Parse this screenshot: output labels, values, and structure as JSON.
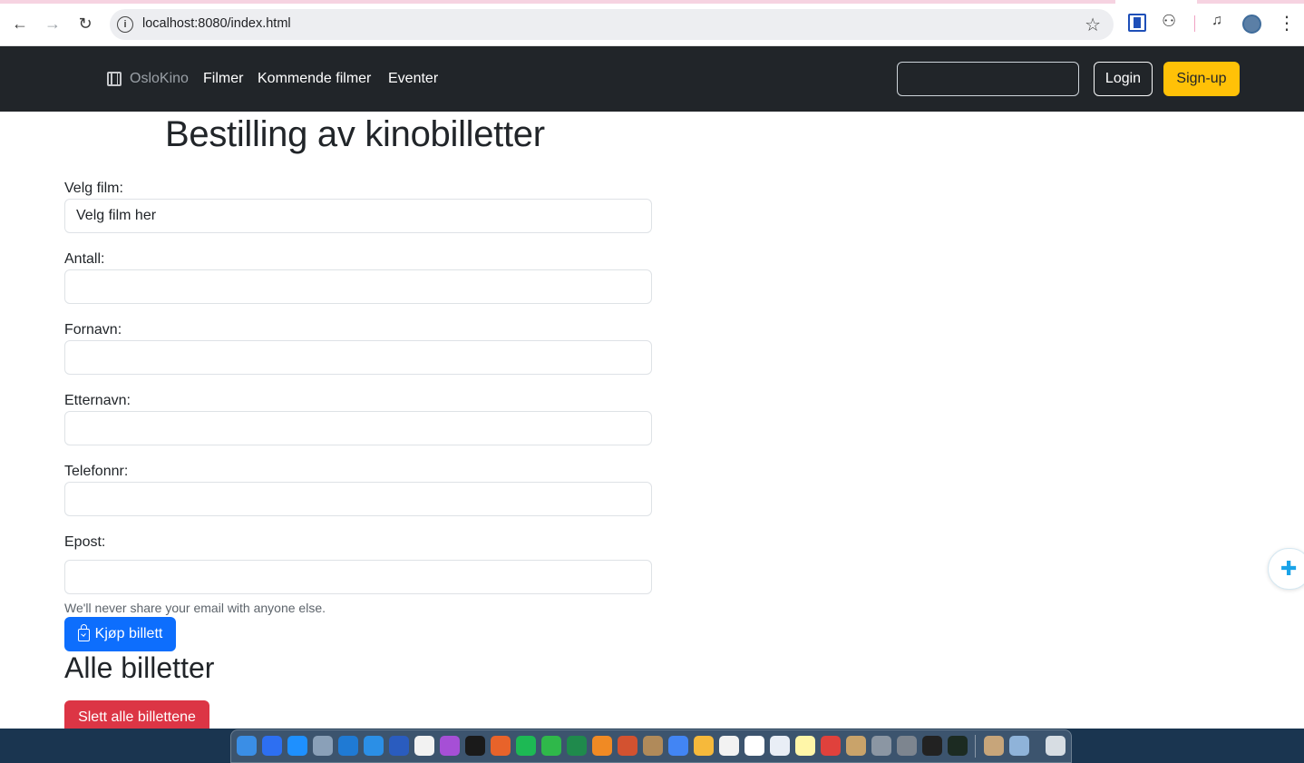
{
  "browser": {
    "url": "localhost:8080/index.html",
    "back_icon": "back-arrow-icon",
    "forward_icon": "forward-arrow-icon",
    "reload_icon": "reload-icon"
  },
  "navbar": {
    "brand": "OsloKino",
    "links": [
      "Filmer",
      "Kommende filmer",
      "Eventer"
    ],
    "search_value": "",
    "login_label": "Login",
    "signup_label": "Sign-up"
  },
  "form": {
    "title": "Bestilling av kinobilletter",
    "film_label": "Velg film:",
    "film_value": "Velg film her",
    "antall_label": "Antall:",
    "fornavn_label": "Fornavn:",
    "etternavn_label": "Etternavn:",
    "telefon_label": "Telefonnr:",
    "epost_label": "Epost:",
    "epost_help": "We'll never share your email with anyone else.",
    "buy_label": "Kjøp billett"
  },
  "tickets": {
    "title": "Alle billetter",
    "delete_label": "Slett alle billettene"
  },
  "colors": {
    "navbar_bg": "#212529",
    "primary": "#0d6efd",
    "warning": "#ffc107",
    "danger": "#dc3545"
  }
}
